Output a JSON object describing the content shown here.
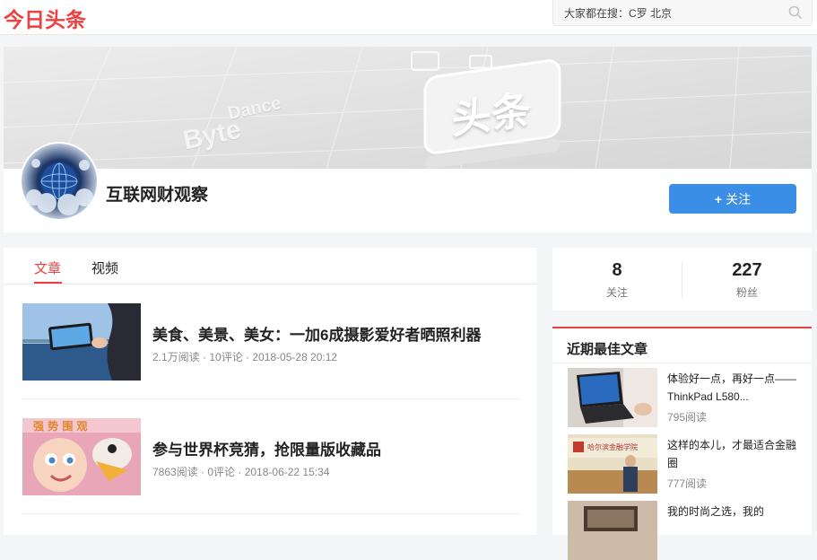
{
  "header": {
    "logo": "今日头条",
    "search_placeholder": "大家都在搜：C罗 北京"
  },
  "profile": {
    "name": "互联网财观察",
    "follow_label": "关注",
    "follow_icon": "plus-icon",
    "banner_text_1": "Dance",
    "banner_text_2": "Byte",
    "banner_logo": "头条"
  },
  "tabs": [
    {
      "label": "文章",
      "active": true
    },
    {
      "label": "视频",
      "active": false
    }
  ],
  "articles": [
    {
      "title": "美食、美景、美女：一加6成摄影爱好者晒照利器",
      "meta": "2.1万阅读 · 10评论 · 2018-05-28 20:12"
    },
    {
      "title": "参与世界杯竞猜，抢限量版收藏品",
      "meta": "7863阅读 · 0评论 · 2018-06-22 15:34"
    }
  ],
  "stats": {
    "following_count": "8",
    "following_label": "关注",
    "fans_count": "227",
    "fans_label": "粉丝"
  },
  "best": {
    "title": "近期最佳文章",
    "items": [
      {
        "title": "体验好一点，再好一点——ThinkPad L580...",
        "reads": "795阅读"
      },
      {
        "title": "这样的本儿，才最适合金融圈",
        "reads": "777阅读"
      },
      {
        "title": "我的时尚之选，我的",
        "reads": ""
      }
    ]
  },
  "colors": {
    "brand_red": "#ed4040",
    "follow_blue": "#3b8ee6"
  }
}
